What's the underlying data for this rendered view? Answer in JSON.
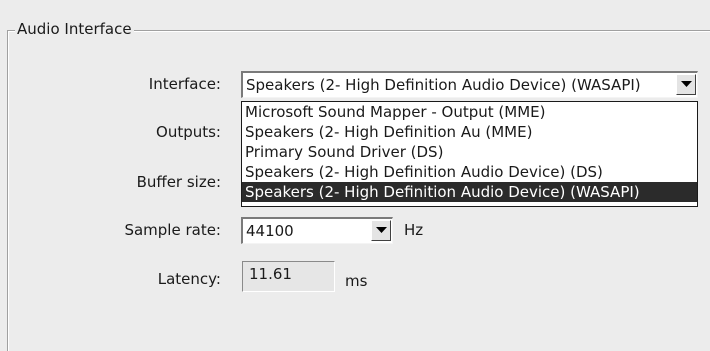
{
  "group": {
    "title": "Audio Interface"
  },
  "labels": {
    "interface": "Interface:",
    "outputs": "Outputs:",
    "buffer_size": "Buffer size:",
    "sample_rate": "Sample rate:",
    "latency": "Latency:"
  },
  "interface": {
    "selected": "Speakers (2- High Definition Audio Device) (WASAPI)",
    "options": [
      "Microsoft Sound Mapper - Output (MME)",
      "Speakers (2- High Definition Au (MME)",
      "Primary Sound Driver (DS)",
      "Speakers (2- High Definition Audio Device) (DS)",
      "Speakers (2- High Definition Audio Device) (WASAPI)"
    ],
    "highlighted_index": 4
  },
  "sample_rate": {
    "value": "44100",
    "unit": "Hz"
  },
  "latency": {
    "value": "11.61",
    "unit": "ms"
  },
  "icons": {
    "dropdown": "chevron-down-icon"
  }
}
